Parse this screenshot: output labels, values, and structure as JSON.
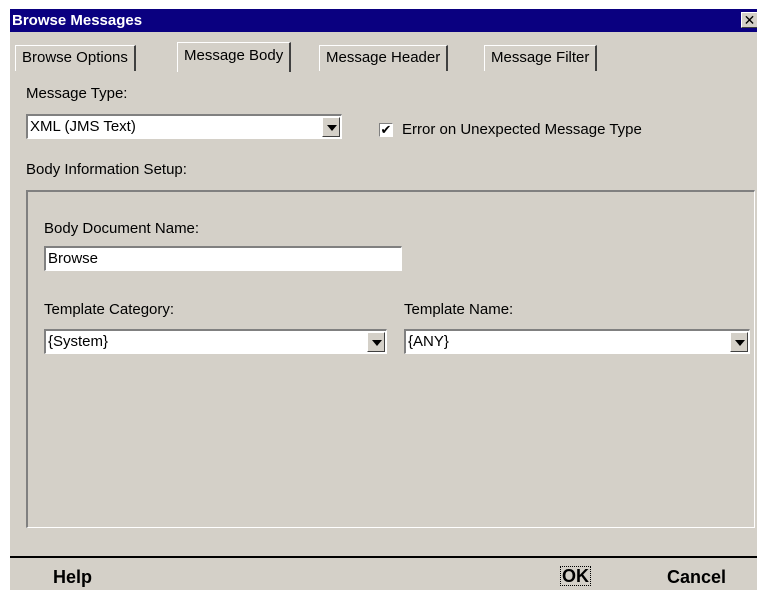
{
  "window": {
    "title": "Browse Messages",
    "close_glyph": "✕"
  },
  "tabs": [
    {
      "label": "Browse Options",
      "active": false
    },
    {
      "label": "Message Body",
      "active": true
    },
    {
      "label": "Message Header",
      "active": false
    },
    {
      "label": "Message Filter",
      "active": false
    }
  ],
  "message_type": {
    "label": "Message Type:",
    "value": "XML (JMS Text)"
  },
  "error_checkbox": {
    "label": "Error on Unexpected Message Type",
    "checked": true,
    "glyph": "✔"
  },
  "body_setup": {
    "label": "Body Information Setup:",
    "document_name_label": "Body Document Name:",
    "document_name_value": "Browse",
    "template_category_label": "Template Category:",
    "template_category_value": "{System}",
    "template_name_label": "Template Name:",
    "template_name_value": "{ANY}"
  },
  "footer": {
    "help": "Help",
    "ok": "OK",
    "cancel": "Cancel"
  },
  "colors": {
    "title_bg": "#0a0080",
    "face": "#d4d0c8"
  }
}
